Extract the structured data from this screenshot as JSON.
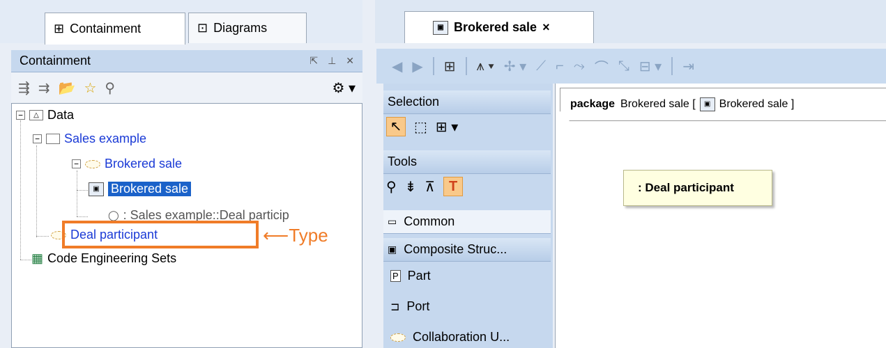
{
  "left_tabs": [
    {
      "label": "Containment",
      "icon": "containment-icon",
      "active": true
    },
    {
      "label": "Diagrams",
      "icon": "diagrams-icon",
      "active": false
    }
  ],
  "containment_panel": {
    "title": "Containment",
    "header_icons": [
      "float-icon",
      "pin-icon",
      "close-icon"
    ]
  },
  "tree": [
    {
      "label": "Data",
      "icon": "package-data-icon",
      "level": 0
    },
    {
      "label": "Sales example",
      "icon": "package-folder-icon",
      "level": 1,
      "color": "#1a3ad6"
    },
    {
      "label": "Brokered sale",
      "icon": "collaboration-icon",
      "level": 2,
      "color": "#1a3ad6"
    },
    {
      "label": "Brokered sale",
      "icon": "composite-diagram-icon",
      "level": 3,
      "selected": true
    },
    {
      "label": ": Sales example::Deal particip",
      "icon": "part-icon",
      "level": 3
    },
    {
      "label": "Deal participant",
      "icon": "collaboration-icon",
      "level": 2,
      "color": "#1a3ad6",
      "highlighted": true
    },
    {
      "label": "Code Engineering Sets",
      "icon": "code-engineering-icon",
      "level": 1
    }
  ],
  "annotation": {
    "label": "Type",
    "color": "#f07c28"
  },
  "diagram_tab": {
    "label": "Brokered sale",
    "close": "×"
  },
  "palette": {
    "groups": [
      {
        "label": "Selection"
      },
      {
        "label": "Tools"
      },
      {
        "label": "Common"
      },
      {
        "label": "Composite Struc..."
      }
    ],
    "items": [
      {
        "label": "Part",
        "icon": "part-icon"
      },
      {
        "label": "Port",
        "icon": "port-icon"
      },
      {
        "label": "Collaboration U...",
        "icon": "collaboration-use-icon"
      }
    ]
  },
  "canvas": {
    "frame_keyword": "package",
    "frame_name": "Brokered sale [",
    "frame_diagram": "Brokered sale ]",
    "shape_label": ": Deal participant"
  }
}
